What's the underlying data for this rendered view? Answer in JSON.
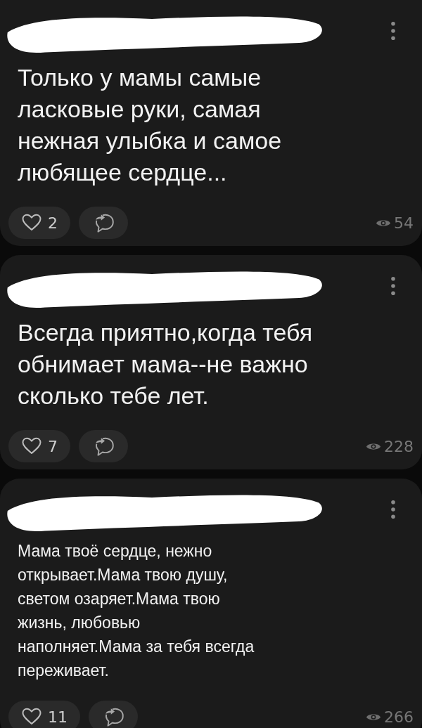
{
  "posts": [
    {
      "kind": "large",
      "text": "Только у мамы самые ласковые руки, самая нежная улыбка и самое любящее сердце...",
      "likes": "2",
      "views": "54"
    },
    {
      "kind": "large",
      "text": "Всегда приятно,когда тебя обнимает мама--не важно сколько тебе лет.",
      "likes": "7",
      "views": "228"
    },
    {
      "kind": "normal",
      "text": "Мама твоё сердце, нежно открывает.Мама твою душу, светом озаряет.Мама твою жизнь, любовью наполняет.Мама за тебя всегда переживает.",
      "likes": "11",
      "views": "266"
    }
  ]
}
